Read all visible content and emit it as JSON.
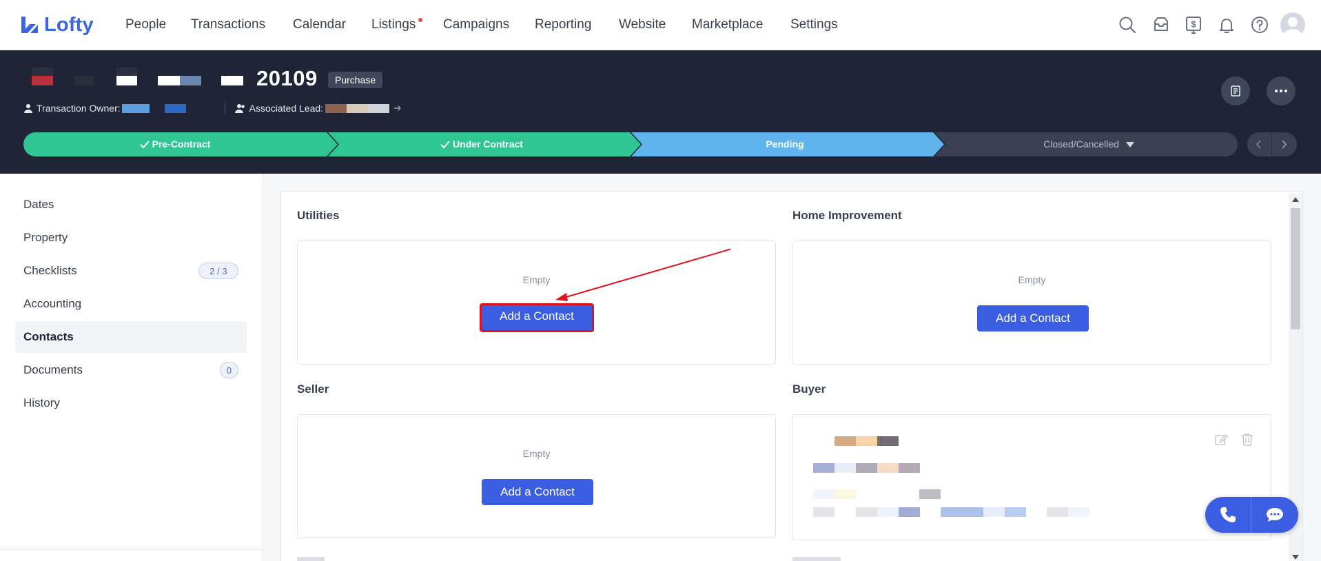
{
  "app": {
    "name": "Lofty",
    "brand_color": "#3d66dc"
  },
  "nav": {
    "items": [
      "People",
      "Transactions",
      "Calendar",
      "Listings",
      "Campaigns",
      "Reporting",
      "Website",
      "Marketplace",
      "Settings"
    ],
    "listings_has_notification": true,
    "icons": [
      "search-icon",
      "inbox-icon",
      "billing-icon",
      "bell-icon",
      "help-icon"
    ]
  },
  "transaction": {
    "number": "20109",
    "type": "Purchase",
    "owner_label": "Transaction Owner:",
    "lead_label": "Associated Lead:"
  },
  "pipeline": {
    "stages": [
      {
        "label": "Pre-Contract",
        "status": "complete",
        "color": "#2fc694"
      },
      {
        "label": "Under Contract",
        "status": "complete",
        "color": "#2fc694"
      },
      {
        "label": "Pending",
        "status": "current",
        "color": "#5fb4ee"
      },
      {
        "label": "Closed/Cancelled",
        "status": "upcoming",
        "color": "#3b4052"
      }
    ]
  },
  "sidebar": {
    "items": [
      {
        "label": "Dates",
        "badge": ""
      },
      {
        "label": "Property",
        "badge": ""
      },
      {
        "label": "Checklists",
        "badge": "2 / 3"
      },
      {
        "label": "Accounting",
        "badge": ""
      },
      {
        "label": "Contacts",
        "badge": "",
        "active": true
      },
      {
        "label": "Documents",
        "badge": "0"
      },
      {
        "label": "History",
        "badge": ""
      }
    ]
  },
  "contacts": {
    "sections": [
      {
        "title": "Utilities",
        "empty_text": "Empty",
        "button": "Add a Contact"
      },
      {
        "title": "Home Improvement",
        "empty_text": "Empty",
        "button": "Add a Contact"
      },
      {
        "title": "Seller",
        "empty_text": "Empty",
        "button": "Add a Contact"
      },
      {
        "title": "Buyer"
      }
    ]
  },
  "annotation": {
    "color": "#e0121a",
    "target": "utilities-add-contact-button"
  }
}
